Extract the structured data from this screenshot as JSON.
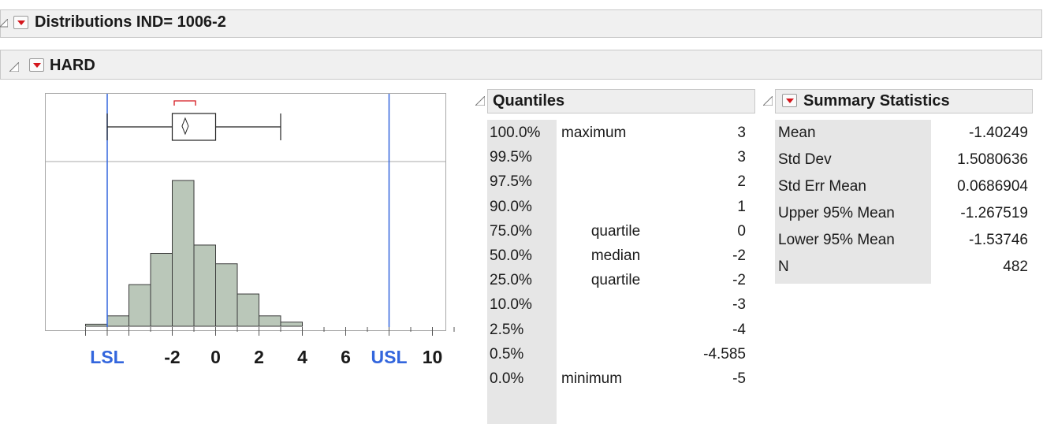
{
  "report": {
    "title": "Distributions IND= 1006-2",
    "column_title": "HARD"
  },
  "colors": {
    "bar_fill": "#bac7b9",
    "spec_line": "#3366dd",
    "mean_bracket": "#d4161c",
    "popup_arrow": "#d4161c"
  },
  "chart_data": {
    "type": "bar",
    "title": "",
    "xlabel": "",
    "ylabel": "",
    "xlim": [
      -6,
      11
    ],
    "bins": [
      {
        "from": -6,
        "to": -5,
        "count": 2
      },
      {
        "from": -5,
        "to": -4,
        "count": 10
      },
      {
        "from": -4,
        "to": -3,
        "count": 40
      },
      {
        "from": -3,
        "to": -2,
        "count": 70
      },
      {
        "from": -2,
        "to": -1,
        "count": 140
      },
      {
        "from": -1,
        "to": 0,
        "count": 78
      },
      {
        "from": 0,
        "to": 1,
        "count": 60
      },
      {
        "from": 1,
        "to": 2,
        "count": 31
      },
      {
        "from": 2,
        "to": 3,
        "count": 10
      },
      {
        "from": 3,
        "to": 4,
        "count": 4
      }
    ],
    "boxplot": {
      "min": -5,
      "q1": -2,
      "median": -2,
      "q3": 0,
      "max": 3,
      "mean": -1.40249,
      "ci_low": -1.53746,
      "ci_high": -1.267519
    },
    "spec_limits": {
      "LSL": -5,
      "USL": 8
    },
    "tick_labels": [
      {
        "value": -5,
        "label": "LSL",
        "spec": true
      },
      {
        "value": -2,
        "label": "-2",
        "spec": false
      },
      {
        "value": 0,
        "label": "0",
        "spec": false
      },
      {
        "value": 2,
        "label": "2",
        "spec": false
      },
      {
        "value": 4,
        "label": "4",
        "spec": false
      },
      {
        "value": 6,
        "label": "6",
        "spec": false
      },
      {
        "value": 8,
        "label": "USL",
        "spec": true
      },
      {
        "value": 10,
        "label": "10",
        "spec": false
      }
    ]
  },
  "quantiles": {
    "title": "Quantiles",
    "rows": [
      {
        "pct": "100.0%",
        "label": "maximum",
        "value": "3"
      },
      {
        "pct": "99.5%",
        "label": "",
        "value": "3"
      },
      {
        "pct": "97.5%",
        "label": "",
        "value": "2"
      },
      {
        "pct": "90.0%",
        "label": "",
        "value": "1"
      },
      {
        "pct": "75.0%",
        "label": "quartile",
        "value": "0"
      },
      {
        "pct": "50.0%",
        "label": "median",
        "value": "-2"
      },
      {
        "pct": "25.0%",
        "label": "quartile",
        "value": "-2"
      },
      {
        "pct": "10.0%",
        "label": "",
        "value": "-3"
      },
      {
        "pct": "2.5%",
        "label": "",
        "value": "-4"
      },
      {
        "pct": "0.5%",
        "label": "",
        "value": "-4.585"
      },
      {
        "pct": "0.0%",
        "label": "minimum",
        "value": "-5"
      }
    ]
  },
  "summary": {
    "title": "Summary Statistics",
    "rows": [
      {
        "label": "Mean",
        "value": "-1.40249"
      },
      {
        "label": "Std Dev",
        "value": "1.5080636"
      },
      {
        "label": "Std Err Mean",
        "value": "0.0686904"
      },
      {
        "label": "Upper 95% Mean",
        "value": "-1.267519"
      },
      {
        "label": "Lower 95% Mean",
        "value": "-1.53746"
      },
      {
        "label": "N",
        "value": "482"
      }
    ]
  }
}
